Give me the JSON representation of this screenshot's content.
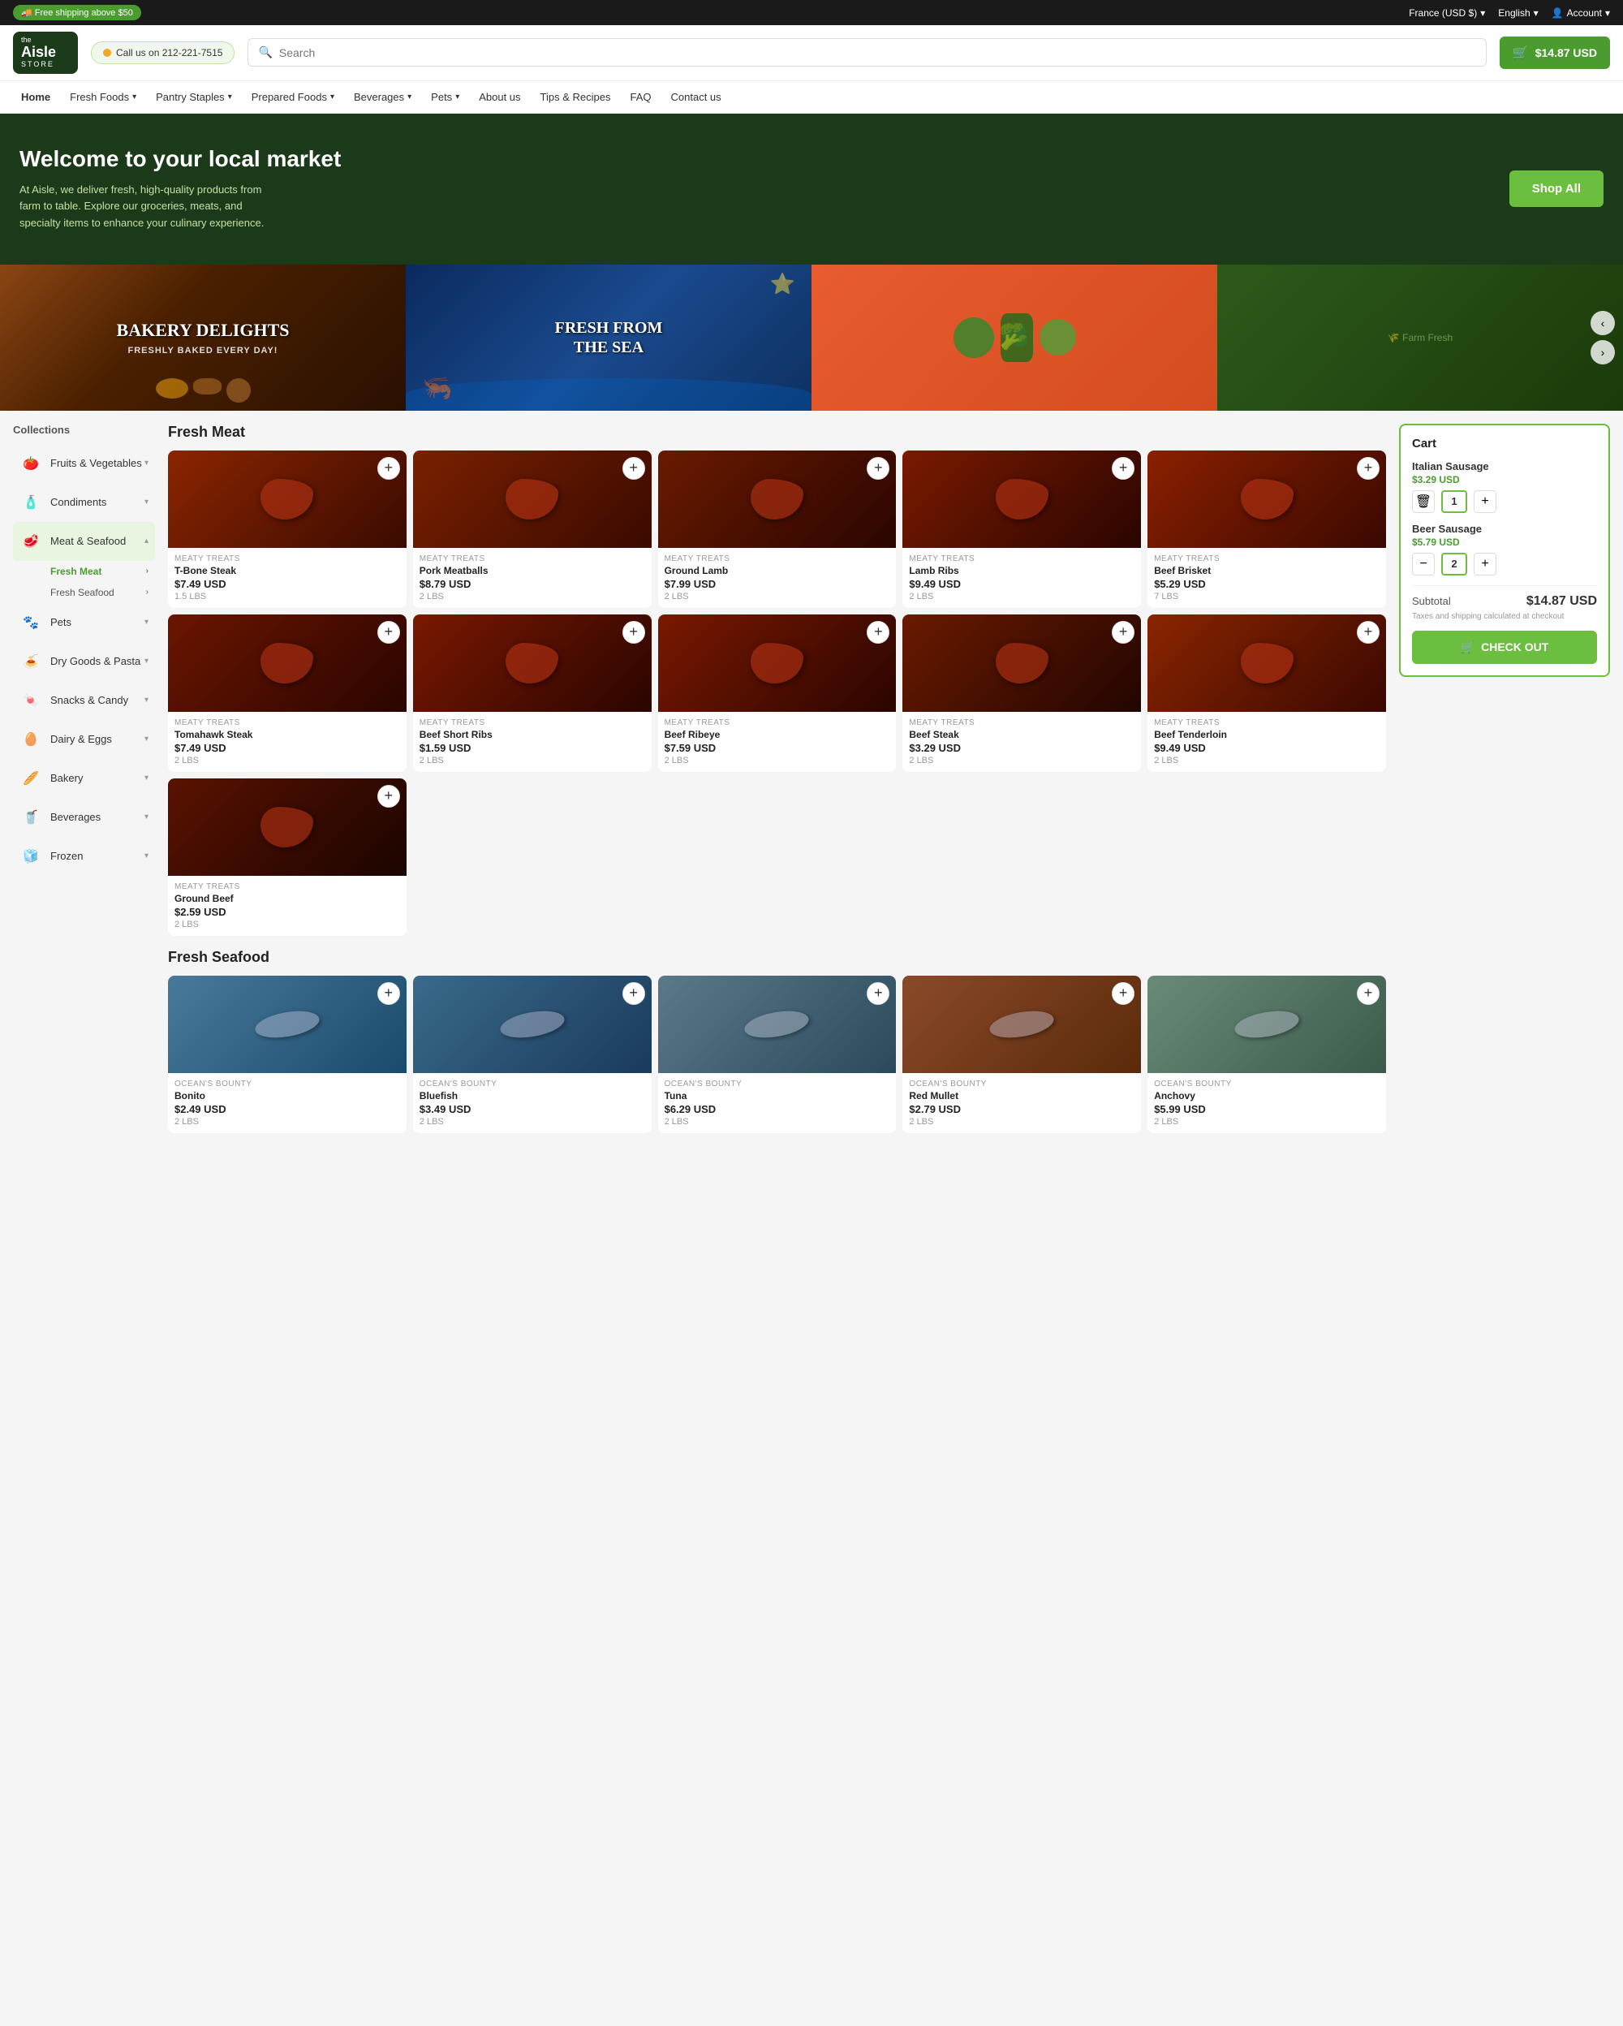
{
  "topBar": {
    "shipping": "🚚 Free shipping above $50",
    "currency": "France (USD $)",
    "language": "English",
    "account": "Account",
    "currency_arrow": "▾",
    "language_arrow": "▾",
    "account_icon": "👤"
  },
  "header": {
    "phone": "Call us on 212-221-7515",
    "phone_dot_color": "#f5a623",
    "search_placeholder": "Search",
    "cart_amount": "$14.87 USD",
    "cart_icon": "🛒"
  },
  "nav": {
    "items": [
      {
        "label": "Home",
        "active": true,
        "dropdown": false
      },
      {
        "label": "Fresh Foods",
        "active": false,
        "dropdown": true
      },
      {
        "label": "Pantry Staples",
        "active": false,
        "dropdown": true
      },
      {
        "label": "Prepared Foods",
        "active": false,
        "dropdown": true
      },
      {
        "label": "Beverages",
        "active": false,
        "dropdown": true
      },
      {
        "label": "Pets",
        "active": false,
        "dropdown": true
      },
      {
        "label": "About us",
        "active": false,
        "dropdown": false
      },
      {
        "label": "Tips & Recipes",
        "active": false,
        "dropdown": false
      },
      {
        "label": "FAQ",
        "active": false,
        "dropdown": false
      },
      {
        "label": "Contact us",
        "active": false,
        "dropdown": false
      }
    ]
  },
  "hero": {
    "title": "Welcome to your local market",
    "description": "At Aisle, we deliver fresh, high-quality products from farm to table. Explore our groceries, meats, and specialty items to enhance your culinary experience.",
    "cta": "Shop All"
  },
  "banners": [
    {
      "label": "BAKERY DELIGHTS",
      "sub": "FRESHLY BAKED EVERY DAY!"
    },
    {
      "label": "FRESH FROM THE SEA",
      "sub": ""
    },
    {
      "label": "",
      "sub": ""
    },
    {
      "label": "",
      "sub": ""
    }
  ],
  "sidebar": {
    "title": "Collections",
    "items": [
      {
        "icon": "🍅",
        "label": "Fruits & Vegetables",
        "expanded": false
      },
      {
        "icon": "🧴",
        "label": "Condiments",
        "expanded": false
      },
      {
        "icon": "🥩",
        "label": "Meat & Seafood",
        "expanded": true
      },
      {
        "icon": "🐾",
        "label": "Pets",
        "expanded": false
      },
      {
        "icon": "🍝",
        "label": "Dry Goods & Pasta",
        "expanded": false
      },
      {
        "icon": "🍬",
        "label": "Snacks & Candy",
        "expanded": false
      },
      {
        "icon": "🥚",
        "label": "Dairy & Eggs",
        "expanded": false
      },
      {
        "icon": "🥖",
        "label": "Bakery",
        "expanded": false
      },
      {
        "icon": "🥤",
        "label": "Beverages",
        "expanded": false
      },
      {
        "icon": "🧊",
        "label": "Frozen",
        "expanded": false
      }
    ],
    "subItems": [
      {
        "label": "Fresh Meat",
        "active": true
      },
      {
        "label": "Fresh Seafood",
        "active": false
      }
    ]
  },
  "freshMeat": {
    "title": "Fresh Meat",
    "products": [
      {
        "brand": "MEATY TREATS",
        "name": "T-Bone Steak",
        "price": "$7.49 USD",
        "weight": "1.5 LBS",
        "imgClass": "img-tbone"
      },
      {
        "brand": "MEATY TREATS",
        "name": "Pork Meatballs",
        "price": "$8.79 USD",
        "weight": "2 LBS",
        "imgClass": "img-meatballs"
      },
      {
        "brand": "MEATY TREATS",
        "name": "Ground Lamb",
        "price": "$7.99 USD",
        "weight": "2 LBS",
        "imgClass": "img-lamb"
      },
      {
        "brand": "MEATY TREATS",
        "name": "Lamb Ribs",
        "price": "$9.49 USD",
        "weight": "2 LBS",
        "imgClass": "img-lambribs"
      },
      {
        "brand": "MEATY TREATS",
        "name": "Beef Brisket",
        "price": "$5.29 USD",
        "weight": "7 LBS",
        "imgClass": "img-brisket"
      },
      {
        "brand": "MEATY TREATS",
        "name": "Tomahawk Steak",
        "price": "$7.49 USD",
        "weight": "2 LBS",
        "imgClass": "img-tomahawk"
      },
      {
        "brand": "MEATY TREATS",
        "name": "Beef Short Ribs",
        "price": "$1.59 USD",
        "weight": "2 LBS",
        "imgClass": "img-beefribs"
      },
      {
        "brand": "MEATY TREATS",
        "name": "Beef Ribeye",
        "price": "$7.59 USD",
        "weight": "2 LBS",
        "imgClass": "img-ribeye"
      },
      {
        "brand": "MEATY TREATS",
        "name": "Beef Steak",
        "price": "$3.29 USD",
        "weight": "2 LBS",
        "imgClass": "img-steak"
      },
      {
        "brand": "MEATY TREATS",
        "name": "Beef Tenderloin",
        "price": "$9.49 USD",
        "weight": "2 LBS",
        "imgClass": "img-tenderloin"
      },
      {
        "brand": "MEATY TREATS",
        "name": "Ground Beef",
        "price": "$2.59 USD",
        "weight": "2 LBS",
        "imgClass": "img-groundbeef"
      }
    ]
  },
  "freshSeafood": {
    "title": "Fresh Seafood",
    "products": [
      {
        "brand": "OCEAN'S BOUNTY",
        "name": "Bonito",
        "price": "$2.49 USD",
        "weight": "2 LBS",
        "imgClass": "img-bonito"
      },
      {
        "brand": "OCEAN'S BOUNTY",
        "name": "Bluefish",
        "price": "$3.49 USD",
        "weight": "2 LBS",
        "imgClass": "img-bluefish"
      },
      {
        "brand": "OCEAN'S BOUNTY",
        "name": "Tuna",
        "price": "$6.29 USD",
        "weight": "2 LBS",
        "imgClass": "img-tuna"
      },
      {
        "brand": "OCEAN'S BOUNTY",
        "name": "Red Mullet",
        "price": "$2.79 USD",
        "weight": "2 LBS",
        "imgClass": "img-redmullet"
      },
      {
        "brand": "OCEAN'S BOUNTY",
        "name": "Anchovy",
        "price": "$5.99 USD",
        "weight": "2 LBS",
        "imgClass": "img-anchovy"
      }
    ]
  },
  "cart": {
    "title": "Cart",
    "items": [
      {
        "name": "Italian Sausage",
        "price": "$3.29 USD",
        "qty": 1
      },
      {
        "name": "Beer Sausage",
        "price": "$5.79 USD",
        "qty": 2
      }
    ],
    "subtotal_label": "Subtotal",
    "subtotal": "$14.87 USD",
    "tax_note": "Taxes and shipping calculated at checkout",
    "checkout_label": "CHECK OUT",
    "checkout_icon": "🛒"
  }
}
